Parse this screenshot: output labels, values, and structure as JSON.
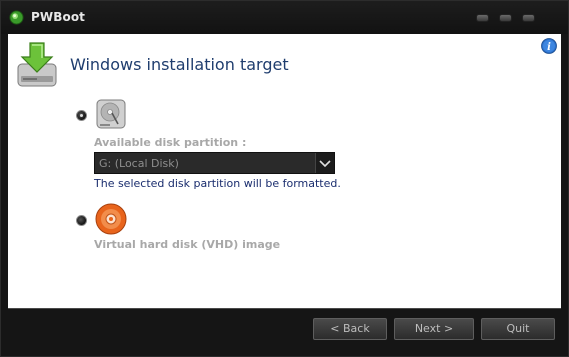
{
  "window": {
    "title": "PWBoot"
  },
  "header": {
    "title": "Windows installation target"
  },
  "options": {
    "disk": {
      "label": "Available disk partition :",
      "selected_value": "G: (Local Disk)",
      "note": "The selected disk partition will be formatted.",
      "checked": true
    },
    "vhd": {
      "label": "Virtual hard disk (VHD) image",
      "checked": false
    }
  },
  "buttons": {
    "back": "< Back",
    "next": "Next >",
    "quit": "Quit"
  },
  "icons": {
    "app": "pwboot-app-icon",
    "info": "info-icon",
    "header": "hdd-download-icon",
    "disk": "hard-disk-icon",
    "vhd": "disc-icon"
  },
  "colors": {
    "accent": "#1f3d6e",
    "note": "#1a2d6e",
    "info": "#2a6fc9"
  }
}
